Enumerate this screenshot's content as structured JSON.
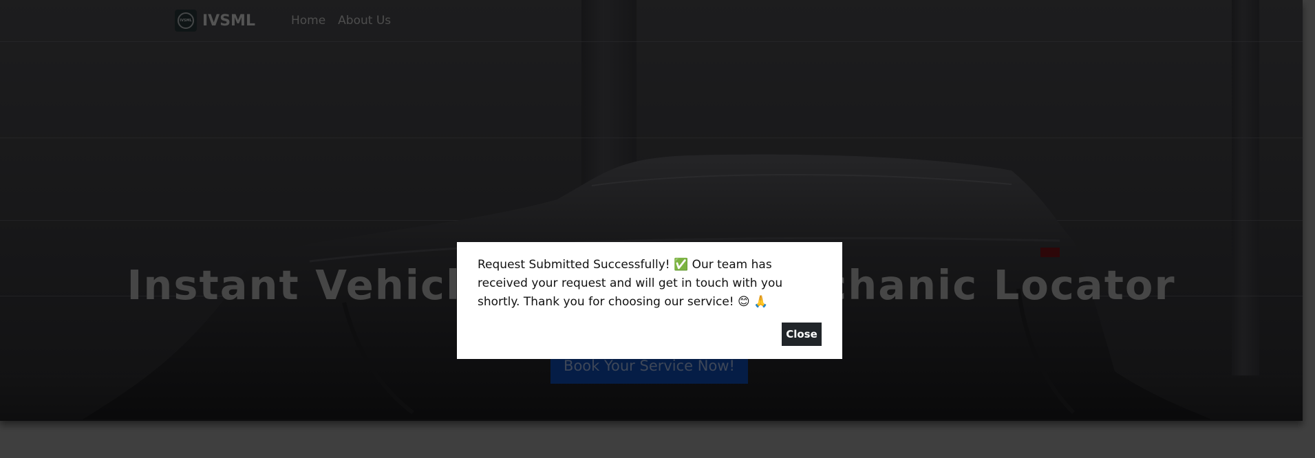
{
  "navbar": {
    "logo_text": "IVSML",
    "brand": "IVSML",
    "links": [
      {
        "label": "Home"
      },
      {
        "label": "About Us"
      }
    ]
  },
  "hero": {
    "title": "Instant Vehicle Service & Mechanic Locator",
    "cta_label": "Book Your Service Now!"
  },
  "modal": {
    "message": "Request Submitted Successfully! ✅ Our team has received your request and will get in touch with you shortly. Thank you for choosing our service! 😊 🙏",
    "close_label": "Close"
  },
  "colors": {
    "cta_background": "#0a3a8c",
    "close_background": "#212529",
    "modal_background": "#ffffff"
  }
}
